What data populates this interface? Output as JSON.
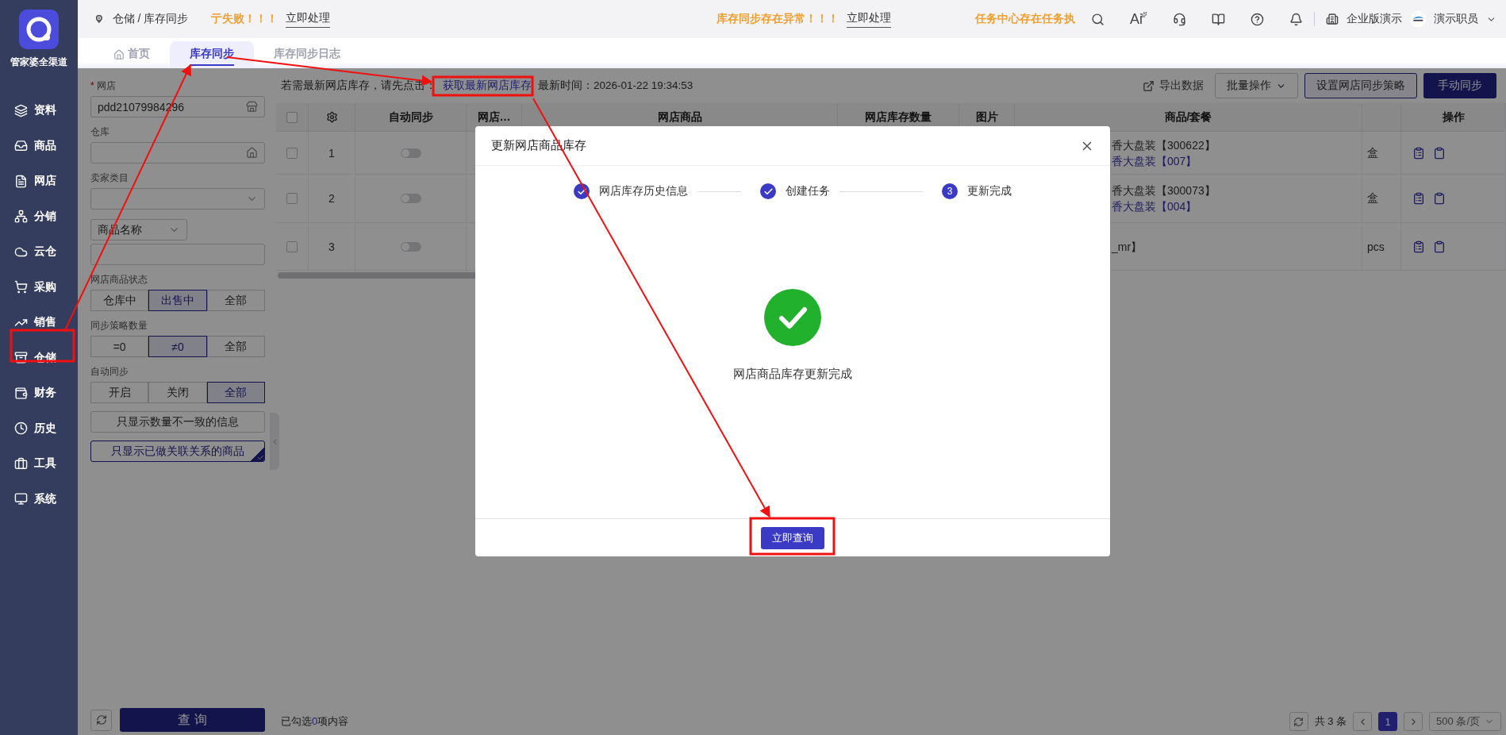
{
  "app": {
    "name": "管家婆全渠道"
  },
  "sidebar": {
    "items": [
      {
        "label": "资料"
      },
      {
        "label": "商品"
      },
      {
        "label": "网店"
      },
      {
        "label": "分销"
      },
      {
        "label": "云仓"
      },
      {
        "label": "采购"
      },
      {
        "label": "销售"
      },
      {
        "label": "仓储"
      },
      {
        "label": "财务"
      },
      {
        "label": "历史"
      },
      {
        "label": "工具"
      },
      {
        "label": "系统"
      }
    ]
  },
  "header": {
    "breadcrumb": "仓储 / 库存同步",
    "notices": [
      {
        "text": "亍失败！！！",
        "action": "立即处理"
      },
      {
        "text": "库存同步存在异常！！！",
        "action": "立即处理"
      },
      {
        "text": "任务中心存在任务执"
      }
    ],
    "ai": "Ai",
    "edition": "企业版演示",
    "user": "演示职员"
  },
  "tabs": [
    {
      "label": "首页",
      "selected": false
    },
    {
      "label": "库存同步",
      "selected": true
    },
    {
      "label": "库存同步日志",
      "selected": false
    }
  ],
  "filters": [
    {
      "kind": "input",
      "label": "网店",
      "required_mark": "*",
      "value": "pdd21079984296"
    },
    {
      "kind": "input",
      "label": "仓库"
    },
    {
      "kind": "select",
      "label": "卖家类目"
    },
    {
      "kind": "select-input",
      "select": "商品名称"
    },
    {
      "kind": "segmented",
      "label": "网店商品状态",
      "options": [
        {
          "label": "仓库中",
          "selected": false
        },
        {
          "label": "出售中",
          "selected": true
        },
        {
          "label": "全部",
          "selected": false
        }
      ]
    },
    {
      "kind": "segmented",
      "label": "同步策略数量",
      "options": [
        {
          "label": "=0",
          "selected": false
        },
        {
          "label": "≠0",
          "selected": true
        },
        {
          "label": "全部",
          "selected": false
        }
      ]
    },
    {
      "kind": "segmented",
      "label": "自动同步",
      "options": [
        {
          "label": "开启",
          "selected": false
        },
        {
          "label": "关闭",
          "selected": false
        },
        {
          "label": "全部",
          "selected": true
        }
      ]
    },
    {
      "kind": "toggle",
      "label": "只显示数量不一致的信息",
      "selected": false
    },
    {
      "kind": "toggle",
      "label": "只显示已做关联关系的商品",
      "selected": true
    }
  ],
  "filter_actions": {
    "search": "查 询"
  },
  "toolbar": {
    "notice": "若需最新网店库存，请先点击：",
    "link": "获取最新网店库存",
    "time": "最新时间：2026-01-22 19:34:53",
    "export": "导出数据",
    "batch": "批量操作",
    "strategy": "设置网店同步策略",
    "sync": "手动同步"
  },
  "table": {
    "all_checked": false,
    "columns": [
      {
        "label": "自动同步"
      },
      {
        "label": "网店…"
      },
      {
        "label": "网店商品"
      },
      {
        "label": "网店库存数量"
      },
      {
        "label": "图片"
      },
      {
        "label": "商品/套餐"
      },
      {
        "label": "操作"
      }
    ],
    "rows": [
      {
        "number": "1",
        "checked": false,
        "auto_sync": false,
        "lines": [
          {
            "text": "香大盘装【300622】",
            "kind": "plain"
          },
          {
            "text": "香大盘装【007】",
            "kind": "link"
          }
        ],
        "unit": "盒"
      },
      {
        "number": "2",
        "checked": false,
        "auto_sync": false,
        "lines": [
          {
            "text": "香大盘装【300073】",
            "kind": "plain"
          },
          {
            "text": "香大盘装【004】",
            "kind": "link"
          }
        ],
        "unit": "盒"
      },
      {
        "number": "3",
        "checked": false,
        "auto_sync": false,
        "lines": [
          {
            "text": "_mr】",
            "kind": "plain"
          }
        ],
        "unit": "pcs"
      }
    ]
  },
  "footer": {
    "selected_prefix": "已勾选",
    "selected_count": "0",
    "selected_suffix": "项内容",
    "total": "共 3 条",
    "pages": [
      {
        "label": "1",
        "selected": true
      }
    ],
    "page_size": "500 条/页"
  },
  "modal": {
    "title": "更新网店商品库存",
    "steps": [
      {
        "label": "网店库存历史信息",
        "kind": "done"
      },
      {
        "label": "创建任务",
        "kind": "done"
      },
      {
        "label": "更新完成",
        "number": "3",
        "kind": "current"
      }
    ],
    "message": "网店商品库存更新完成",
    "button": "立即查询"
  }
}
